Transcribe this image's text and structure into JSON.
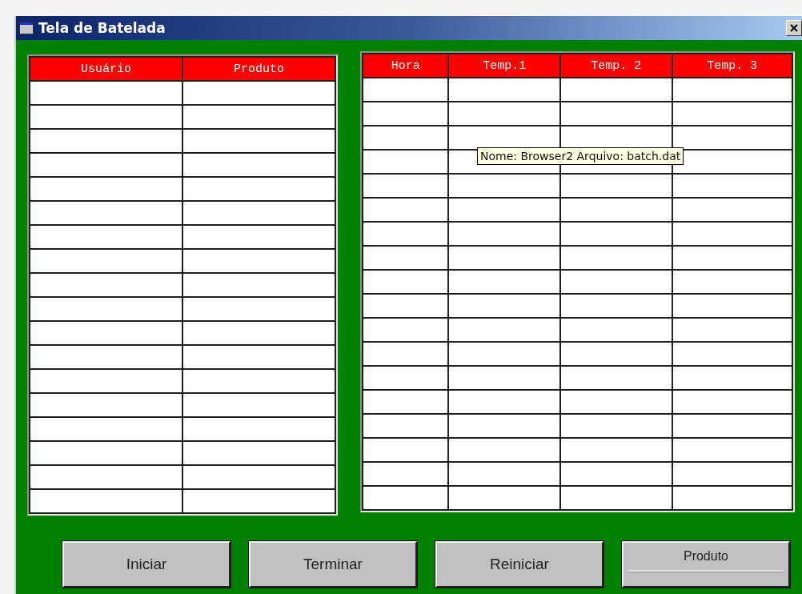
{
  "window": {
    "title": "Tela de Batelada"
  },
  "left_table": {
    "columns": [
      "Usuário",
      "Produto"
    ]
  },
  "right_table": {
    "columns": [
      "Hora",
      "Temp.1",
      "Temp. 2",
      "Temp. 3"
    ]
  },
  "tooltip": {
    "text": "Nome: Browser2  Arquivo: batch.dat"
  },
  "buttons": [
    "Iniciar",
    "Terminar",
    "Reiniciar",
    "Produto"
  ]
}
